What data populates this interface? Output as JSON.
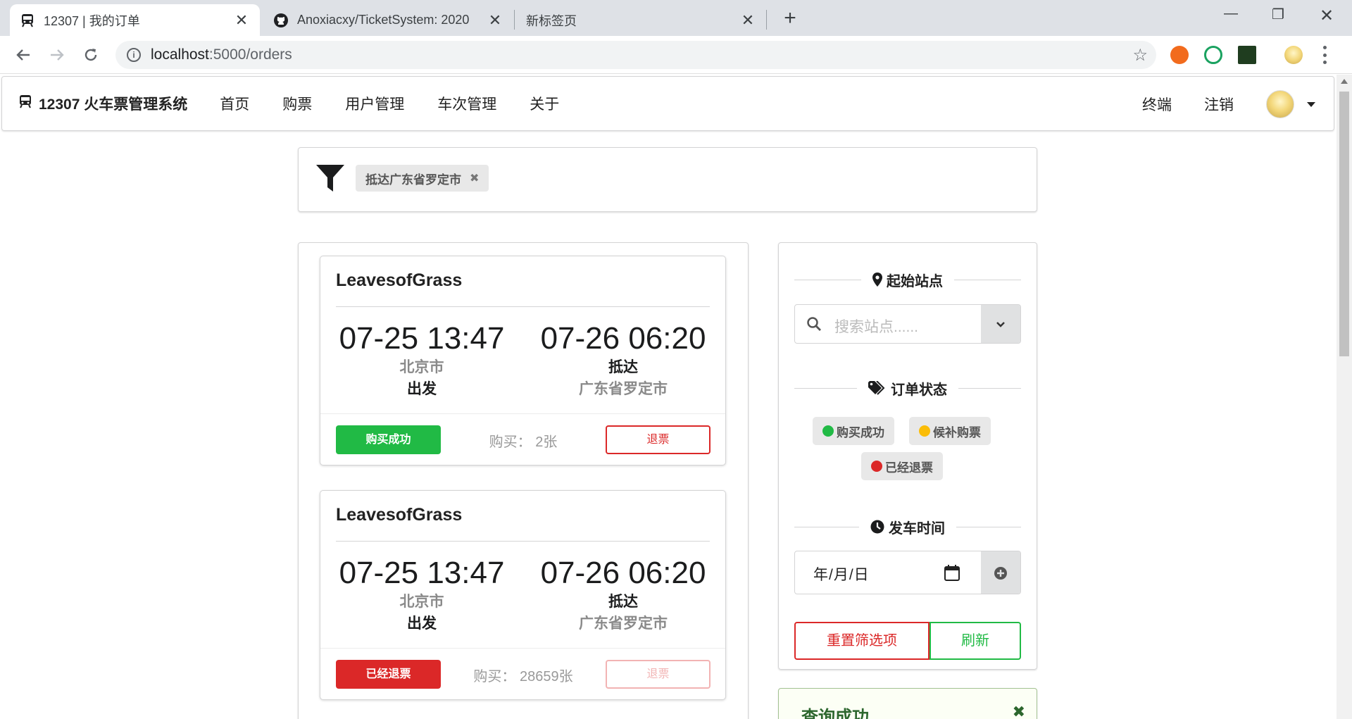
{
  "browser": {
    "tabs": [
      {
        "title": "12307 | 我的订单",
        "icon": "train-icon"
      },
      {
        "title": "Anoxiacxy/TicketSystem: 2020",
        "icon": "github-icon"
      },
      {
        "title": "新标签页",
        "icon": ""
      }
    ],
    "url_host": "localhost",
    "url_rest": ":5000/orders"
  },
  "app": {
    "brand": "12307 火车票管理系统",
    "menu": [
      "首页",
      "购票",
      "用户管理",
      "车次管理",
      "关于"
    ],
    "right_menu": [
      "终端",
      "注销"
    ]
  },
  "filter": {
    "chip": "抵达广东省罗定市"
  },
  "orders": [
    {
      "train": "LeavesofGrass",
      "depart_time": "07-25 13:47",
      "depart_station": "北京市",
      "depart_label": "出发",
      "arrive_time": "07-26 06:20",
      "arrive_label": "抵达",
      "arrive_station": "广东省罗定市",
      "status": "购买成功",
      "status_color": "#21ba45",
      "buy": "购买： 2张",
      "refund": "退票",
      "refund_enabled": true
    },
    {
      "train": "LeavesofGrass",
      "depart_time": "07-25 13:47",
      "depart_station": "北京市",
      "depart_label": "出发",
      "arrive_time": "07-26 06:20",
      "arrive_label": "抵达",
      "arrive_station": "广东省罗定市",
      "status": "已经退票",
      "status_color": "#db2828",
      "buy": "购买： 28659张",
      "refund": "退票",
      "refund_enabled": false
    }
  ],
  "sidebar": {
    "start_station_title": "起始站点",
    "search_placeholder": "搜索站点......",
    "order_status_title": "订单状态",
    "statuses": [
      {
        "label": "购买成功",
        "color": "#21ba45"
      },
      {
        "label": "候补购票",
        "color": "#fbbd08"
      },
      {
        "label": "已经退票",
        "color": "#db2828"
      }
    ],
    "depart_time_title": "发车时间",
    "date_placeholder": "年/月/日",
    "reset": "重置筛选项",
    "refresh": "刷新"
  },
  "message": {
    "title": "查询成功"
  },
  "colors": {
    "green": "#21ba45",
    "red": "#db2828",
    "yellow": "#fbbd08"
  }
}
